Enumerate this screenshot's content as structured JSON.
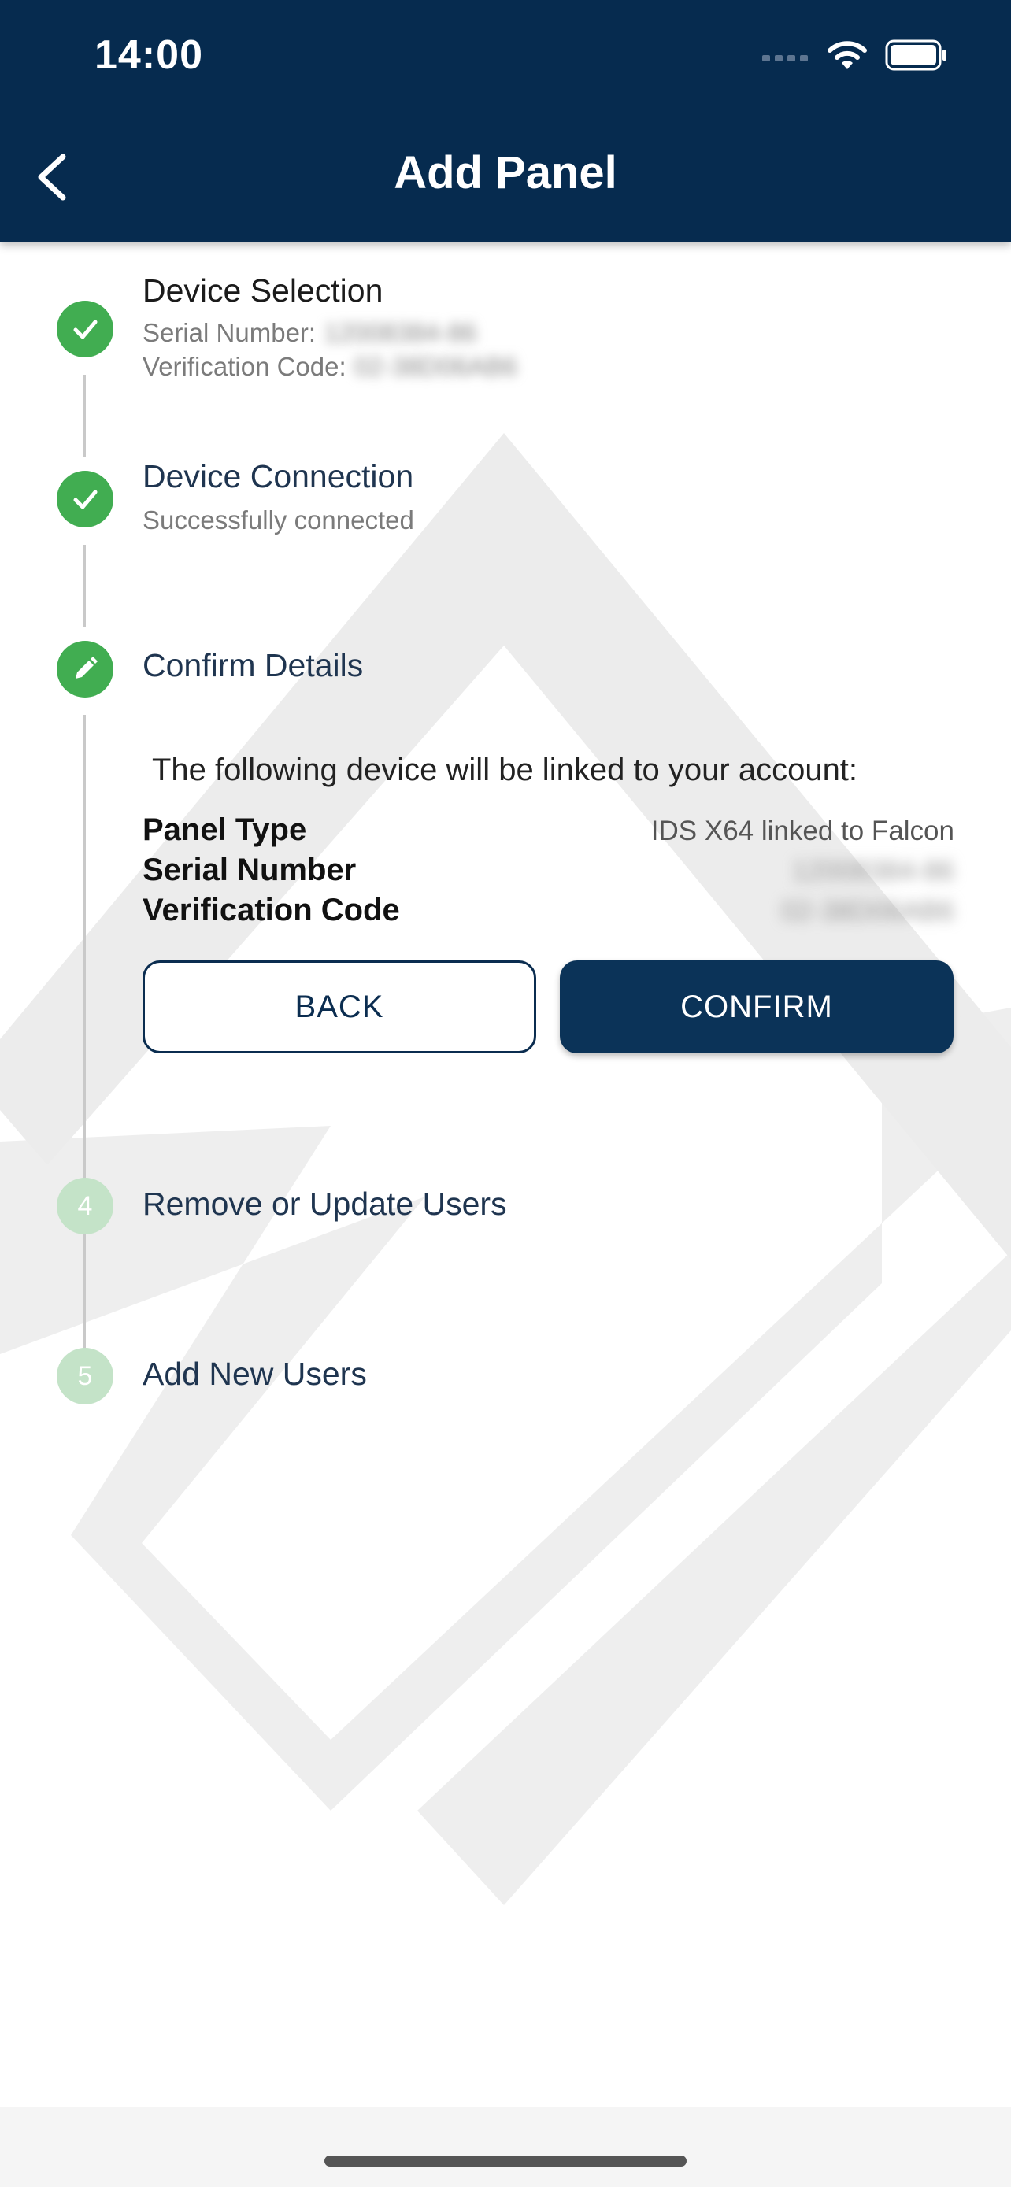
{
  "status_bar": {
    "time": "14:00"
  },
  "header": {
    "title": "Add Panel"
  },
  "steps": [
    {
      "title": "Device Selection",
      "serial_label": "Serial Number:",
      "serial_value": "12008384-86",
      "verification_label": "Verification Code:",
      "verification_value": "02-38D06AB6",
      "state": "done"
    },
    {
      "title": "Device Connection",
      "subtitle": "Successfully connected",
      "state": "done"
    },
    {
      "title": "Confirm Details",
      "state": "active"
    },
    {
      "number": "4",
      "title": "Remove or Update Users",
      "state": "pending"
    },
    {
      "number": "5",
      "title": "Add New Users",
      "state": "pending"
    }
  ],
  "confirm": {
    "intro": "The following device will be linked to your account:",
    "panel_type_label": "Panel Type",
    "panel_type_value": "IDS X64 linked to Falcon",
    "serial_label": "Serial Number",
    "serial_value": "12008384-86",
    "verification_label": "Verification Code",
    "verification_value": "02-38D06AB6",
    "back_label": "BACK",
    "confirm_label": "CONFIRM"
  },
  "colors": {
    "header": "#062b4f",
    "done": "#41ad51",
    "pending": "#c4e3c8",
    "primary_button": "#0b3358"
  }
}
